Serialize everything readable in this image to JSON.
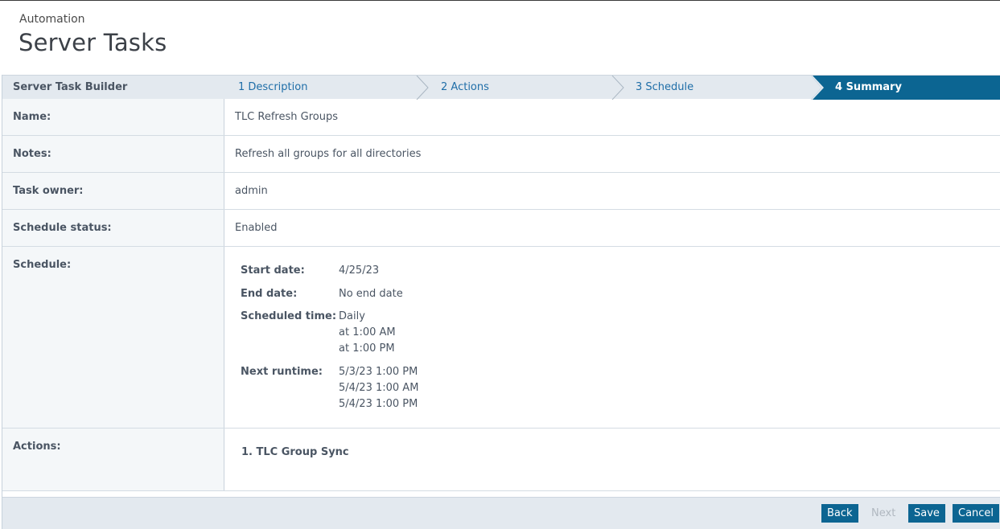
{
  "header": {
    "breadcrumb": "Automation",
    "title": "Server Tasks"
  },
  "wizard": {
    "title": "Server Task Builder",
    "steps": [
      {
        "label": "1 Description",
        "active": false
      },
      {
        "label": "2 Actions",
        "active": false
      },
      {
        "label": "3 Schedule",
        "active": false
      },
      {
        "label": "4 Summary",
        "active": true
      }
    ]
  },
  "summary": {
    "name_label": "Name:",
    "name_value": "TLC Refresh Groups",
    "notes_label": "Notes:",
    "notes_value": "Refresh all groups for all directories",
    "owner_label": "Task owner:",
    "owner_value": "admin",
    "status_label": "Schedule status:",
    "status_value": "Enabled",
    "schedule_label": "Schedule:",
    "schedule": {
      "start_label": "Start date:",
      "start_value": "4/25/23",
      "end_label": "End date:",
      "end_value": "No end date",
      "time_label": "Scheduled time:",
      "time_values": [
        "Daily",
        "at 1:00 AM",
        "at 1:00 PM"
      ],
      "next_label": "Next runtime:",
      "next_values": [
        "5/3/23 1:00 PM",
        "5/4/23 1:00 AM",
        "5/4/23 1:00 PM"
      ]
    },
    "actions_label": "Actions:",
    "actions": [
      "1.  TLC Group Sync"
    ]
  },
  "footer": {
    "back": "Back",
    "next": "Next",
    "save": "Save",
    "cancel": "Cancel"
  },
  "colors": {
    "accent": "#0c6592",
    "link": "#1f6ea8",
    "bar_bg": "#e3e9ef"
  }
}
